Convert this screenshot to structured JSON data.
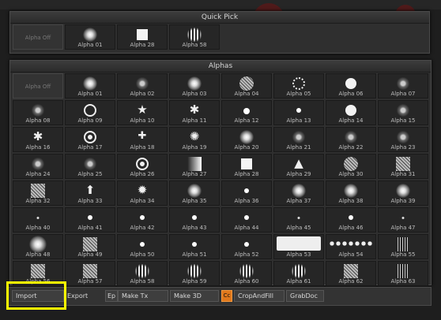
{
  "quick_pick": {
    "title": "Quick Pick",
    "items": [
      {
        "label": "Alpha Off",
        "icon": "off"
      },
      {
        "label": "Alpha 01",
        "icon": "blob"
      },
      {
        "label": "Alpha 28",
        "icon": "square"
      },
      {
        "label": "Alpha 58",
        "icon": "bars"
      }
    ]
  },
  "alphas": {
    "title": "Alphas",
    "items": [
      {
        "label": "Alpha Off",
        "icon": "off"
      },
      {
        "label": "Alpha 01",
        "icon": "blob"
      },
      {
        "label": "Alpha 02",
        "icon": "speck"
      },
      {
        "label": "Alpha 03",
        "icon": "blob"
      },
      {
        "label": "Alpha 04",
        "icon": "noise-round"
      },
      {
        "label": "Alpha 05",
        "icon": "ring-dotted"
      },
      {
        "label": "Alpha 06",
        "icon": "disk"
      },
      {
        "label": "Alpha 07",
        "icon": "speck"
      },
      {
        "label": "Alpha 08",
        "icon": "speck"
      },
      {
        "label": "Alpha 09",
        "icon": "ring"
      },
      {
        "label": "Alpha 10",
        "icon": "star"
      },
      {
        "label": "Alpha 11",
        "icon": "asterisk"
      },
      {
        "label": "Alpha 12",
        "icon": "dot"
      },
      {
        "label": "Alpha 13",
        "icon": "dot-small"
      },
      {
        "label": "Alpha 14",
        "icon": "disk"
      },
      {
        "label": "Alpha 15",
        "icon": "speck"
      },
      {
        "label": "Alpha 16",
        "icon": "asterisk"
      },
      {
        "label": "Alpha 17",
        "icon": "target"
      },
      {
        "label": "Alpha 18",
        "icon": "cross-blob"
      },
      {
        "label": "Alpha 19",
        "icon": "swirl"
      },
      {
        "label": "Alpha 20",
        "icon": "blob"
      },
      {
        "label": "Alpha 21",
        "icon": "speck"
      },
      {
        "label": "Alpha 22",
        "icon": "speck"
      },
      {
        "label": "Alpha 23",
        "icon": "speck"
      },
      {
        "label": "Alpha 24",
        "icon": "speck"
      },
      {
        "label": "Alpha 25",
        "icon": "speck"
      },
      {
        "label": "Alpha 26",
        "icon": "target"
      },
      {
        "label": "Alpha 27",
        "icon": "gradient-square"
      },
      {
        "label": "Alpha 28",
        "icon": "square"
      },
      {
        "label": "Alpha 29",
        "icon": "tree"
      },
      {
        "label": "Alpha 30",
        "icon": "noise-round"
      },
      {
        "label": "Alpha 31",
        "icon": "noise"
      },
      {
        "label": "Alpha 32",
        "icon": "noise"
      },
      {
        "label": "Alpha 33",
        "icon": "arrow"
      },
      {
        "label": "Alpha 34",
        "icon": "sunburst"
      },
      {
        "label": "Alpha 35",
        "icon": "blob"
      },
      {
        "label": "Alpha 36",
        "icon": "dot-small"
      },
      {
        "label": "Alpha 37",
        "icon": "blob"
      },
      {
        "label": "Alpha 38",
        "icon": "blob"
      },
      {
        "label": "Alpha 39",
        "icon": "blob"
      },
      {
        "label": "Alpha 40",
        "icon": "tiny"
      },
      {
        "label": "Alpha 41",
        "icon": "dot-small"
      },
      {
        "label": "Alpha 42",
        "icon": "dot-small"
      },
      {
        "label": "Alpha 43",
        "icon": "dot-small"
      },
      {
        "label": "Alpha 44",
        "icon": "dot-small"
      },
      {
        "label": "Alpha 45",
        "icon": "tiny"
      },
      {
        "label": "Alpha 46",
        "icon": "dot-small"
      },
      {
        "label": "Alpha 47",
        "icon": "tiny"
      },
      {
        "label": "Alpha 48",
        "icon": "blob-large"
      },
      {
        "label": "Alpha 49",
        "icon": "noise"
      },
      {
        "label": "Alpha 50",
        "icon": "dot-small"
      },
      {
        "label": "Alpha 51",
        "icon": "dot-small"
      },
      {
        "label": "Alpha 52",
        "icon": "dot-small"
      },
      {
        "label": "Alpha 53",
        "icon": "wide-pattern"
      },
      {
        "label": "Alpha 54",
        "icon": "row-dots"
      },
      {
        "label": "Alpha 55",
        "icon": "scratch"
      },
      {
        "label": "Alpha 56",
        "icon": "noise"
      },
      {
        "label": "Alpha 57",
        "icon": "noise"
      },
      {
        "label": "Alpha 58",
        "icon": "bars"
      },
      {
        "label": "Alpha 59",
        "icon": "bars"
      },
      {
        "label": "Alpha 60",
        "icon": "bars"
      },
      {
        "label": "Alpha 61",
        "icon": "bars"
      },
      {
        "label": "Alpha 62",
        "icon": "noise"
      },
      {
        "label": "Alpha 63",
        "icon": "scratch"
      }
    ]
  },
  "toolbar": {
    "import_label": "Import",
    "export_label": "Export",
    "ep_label": "Ep",
    "make_tx_label": "Make Tx",
    "make_3d_label": "Make 3D",
    "cc_label": "Cc",
    "crop_and_fill_label": "CropAndFill",
    "grab_doc_label": "GrabDoc"
  },
  "colors": {
    "highlight": "#ffff00",
    "orange_button": "#e0781c"
  }
}
